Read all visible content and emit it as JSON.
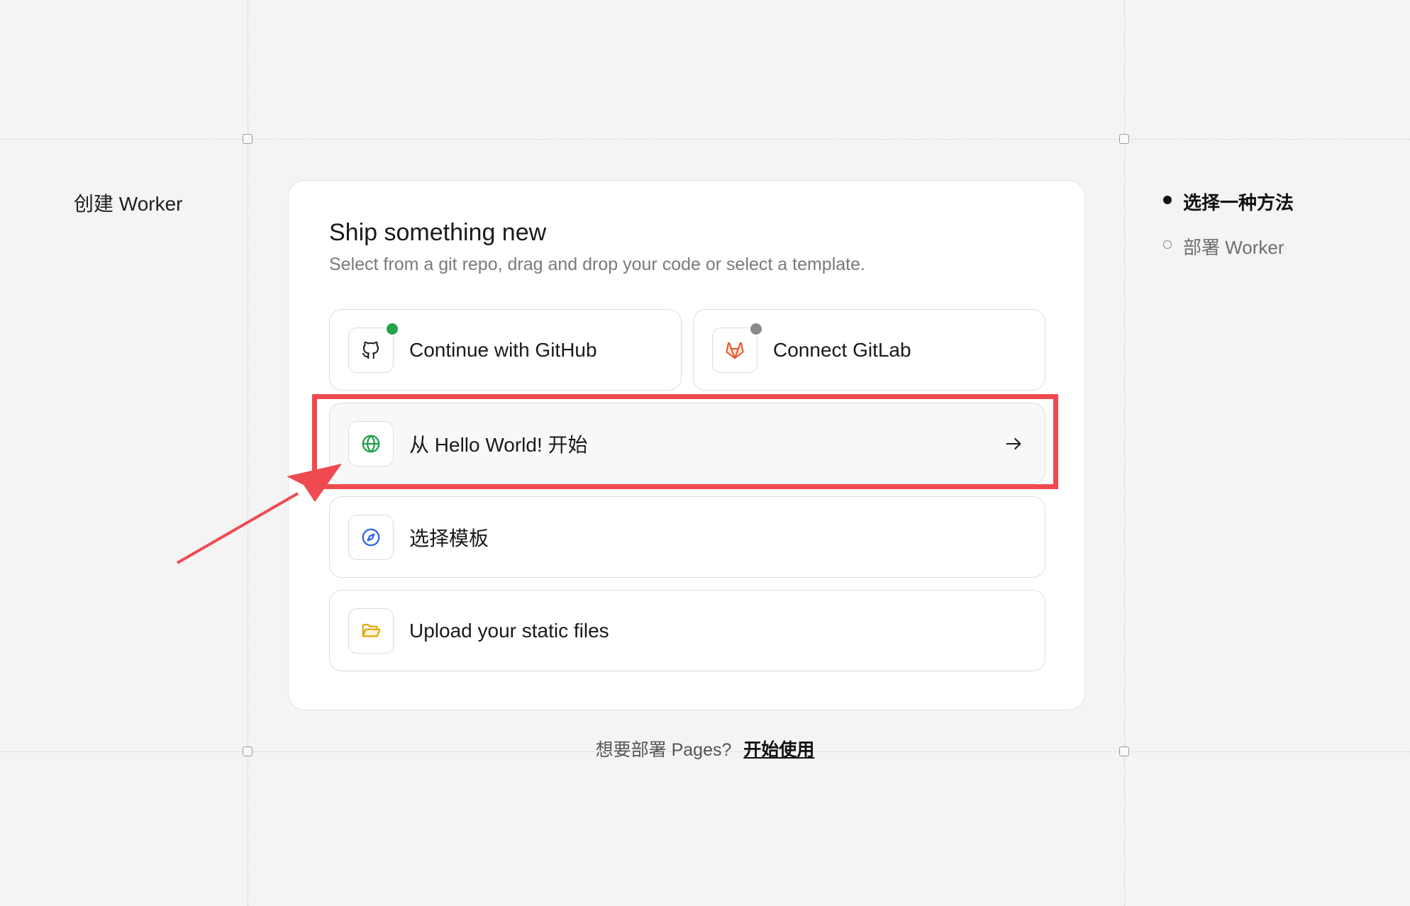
{
  "page": {
    "heading": "创建 Worker"
  },
  "card": {
    "title": "Ship something new",
    "subtitle": "Select from a git repo, drag and drop your code or select a template."
  },
  "options": {
    "github": {
      "label": "Continue with GitHub",
      "icon": "github-icon",
      "status_color": "#22a447"
    },
    "gitlab": {
      "label": "Connect GitLab",
      "icon": "gitlab-icon",
      "status_color": "#8a8a8a"
    },
    "hello_world": {
      "label": "从 Hello World! 开始",
      "icon": "globe-icon",
      "trailing_icon": "arrow-right-icon"
    },
    "template": {
      "label": "选择模板",
      "icon": "compass-icon"
    },
    "upload": {
      "label": "Upload your static files",
      "icon": "folder-open-icon"
    }
  },
  "footer": {
    "prompt": "想要部署 Pages?",
    "link": "开始使用"
  },
  "steps": [
    {
      "label": "选择一种方法",
      "state": "active"
    },
    {
      "label": "部署 Worker",
      "state": "inactive"
    }
  ],
  "annotation": {
    "color": "#ef4a4f"
  }
}
